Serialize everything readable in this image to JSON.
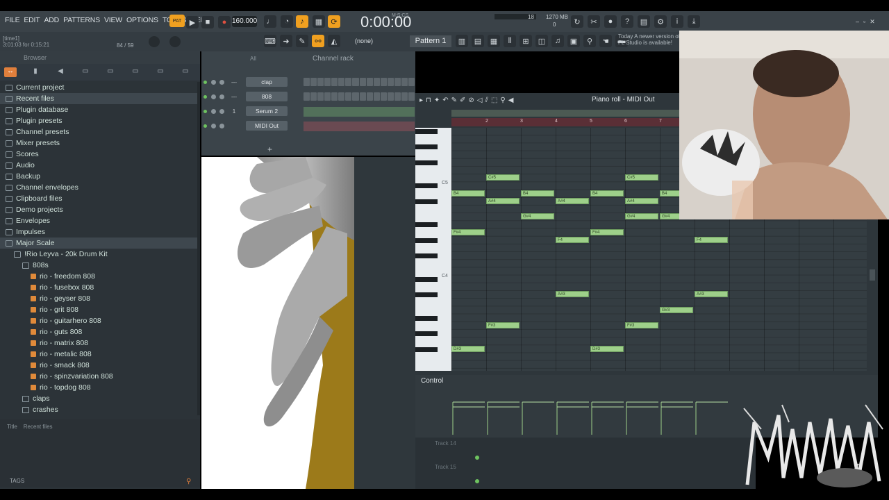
{
  "menu": [
    "FILE",
    "EDIT",
    "ADD",
    "PATTERNS",
    "VIEW",
    "OPTIONS",
    "TOOLS",
    "HELP"
  ],
  "hint": {
    "line1": "[time1]",
    "line2": "3:01:03 for 0:15:21",
    "counter": "84 / 59"
  },
  "transport": {
    "pat_label": "PAT",
    "tempo": "160.000",
    "time": "0:00:00",
    "time_unit": "M:S:CS",
    "cpu": "18",
    "mem": "1270 MB",
    "poly": "0"
  },
  "toolbar2": {
    "preset": "(none)",
    "pattern": "Pattern 1"
  },
  "news": {
    "line1": "Today  A newer version of",
    "line2": "FL Studio is available!"
  },
  "browser": {
    "title": "Browser",
    "items": [
      {
        "label": "Current project",
        "level": 0
      },
      {
        "label": "Recent files",
        "level": 0,
        "selected": true
      },
      {
        "label": "Plugin database",
        "level": 0
      },
      {
        "label": "Plugin presets",
        "level": 0
      },
      {
        "label": "Channel presets",
        "level": 0
      },
      {
        "label": "Mixer presets",
        "level": 0
      },
      {
        "label": "Scores",
        "level": 0
      },
      {
        "label": "Audio",
        "level": 0
      },
      {
        "label": "Backup",
        "level": 0
      },
      {
        "label": "Channel envelopes",
        "level": 0
      },
      {
        "label": "Clipboard files",
        "level": 0
      },
      {
        "label": "Demo projects",
        "level": 0
      },
      {
        "label": "Envelopes",
        "level": 0
      },
      {
        "label": "Impulses",
        "level": 0
      },
      {
        "label": "Major Scale",
        "level": 0,
        "selected": true
      },
      {
        "label": "!Rio Leyva - 20k Drum Kit",
        "level": 1
      },
      {
        "label": "808s",
        "level": 2
      },
      {
        "label": "rio - freedom 808",
        "level": 3,
        "file": true
      },
      {
        "label": "rio - fusebox 808",
        "level": 3,
        "file": true
      },
      {
        "label": "rio - geyser 808",
        "level": 3,
        "file": true
      },
      {
        "label": "rio - grit 808",
        "level": 3,
        "file": true
      },
      {
        "label": "rio - guitarhero 808",
        "level": 3,
        "file": true
      },
      {
        "label": "rio - guts 808",
        "level": 3,
        "file": true
      },
      {
        "label": "rio - matrix 808",
        "level": 3,
        "file": true
      },
      {
        "label": "rio - metalic 808",
        "level": 3,
        "file": true
      },
      {
        "label": "rio - smack 808",
        "level": 3,
        "file": true
      },
      {
        "label": "rio - spinzvariation 808",
        "level": 3,
        "file": true
      },
      {
        "label": "rio - topdog 808",
        "level": 3,
        "file": true
      },
      {
        "label": "claps",
        "level": 2
      },
      {
        "label": "crashes",
        "level": 2
      }
    ],
    "bottom_title": "Title",
    "bottom_recent": "Recent files",
    "tags": "TAGS"
  },
  "channel_rack": {
    "title": "Channel rack",
    "filter": "All",
    "channels": [
      {
        "name": "clap",
        "num": "---"
      },
      {
        "name": "808",
        "num": "---"
      },
      {
        "name": "Serum 2",
        "num": "1"
      },
      {
        "name": "MIDI Out",
        "num": ""
      }
    ]
  },
  "piano_roll": {
    "title": "Piano roll - MIDI Out",
    "ruler": [
      "2",
      "3",
      "4",
      "5",
      "6",
      "7"
    ],
    "octaves": [
      "C5",
      "C4"
    ],
    "control_label": "Control",
    "notes": [
      {
        "label": "C#5",
        "bar": 1.0,
        "row": 6
      },
      {
        "label": "C#5",
        "bar": 5.0,
        "row": 6
      },
      {
        "label": "B4",
        "bar": 0.0,
        "row": 8
      },
      {
        "label": "B4",
        "bar": 2.0,
        "row": 8
      },
      {
        "label": "B4",
        "bar": 4.0,
        "row": 8
      },
      {
        "label": "B4",
        "bar": 6.0,
        "row": 8
      },
      {
        "label": "A#4",
        "bar": 1.0,
        "row": 9
      },
      {
        "label": "A#4",
        "bar": 3.0,
        "row": 9
      },
      {
        "label": "A#4",
        "bar": 5.0,
        "row": 9
      },
      {
        "label": "G#4",
        "bar": 2.0,
        "row": 11
      },
      {
        "label": "G#4",
        "bar": 5.0,
        "row": 11
      },
      {
        "label": "G#4",
        "bar": 6.0,
        "row": 11
      },
      {
        "label": "F#4",
        "bar": 0.0,
        "row": 13
      },
      {
        "label": "F#4",
        "bar": 4.0,
        "row": 13
      },
      {
        "label": "F4",
        "bar": 3.0,
        "row": 14
      },
      {
        "label": "F4",
        "bar": 7.0,
        "row": 14
      },
      {
        "label": "A#3",
        "bar": 3.0,
        "row": 21
      },
      {
        "label": "A#3",
        "bar": 7.0,
        "row": 21
      },
      {
        "label": "G#3",
        "bar": 6.0,
        "row": 23
      },
      {
        "label": "F#3",
        "bar": 1.0,
        "row": 25
      },
      {
        "label": "F#3",
        "bar": 5.0,
        "row": 25
      },
      {
        "label": "D#3",
        "bar": 0.0,
        "row": 28
      },
      {
        "label": "D#3",
        "bar": 4.0,
        "row": 28
      }
    ]
  },
  "playlist": {
    "tracks": [
      "Track 14",
      "Track 15"
    ]
  },
  "colors": {
    "accent": "#e07f3c",
    "note": "#9ed08a",
    "led": "#6ec35f",
    "ruler": "#5a2f36"
  }
}
